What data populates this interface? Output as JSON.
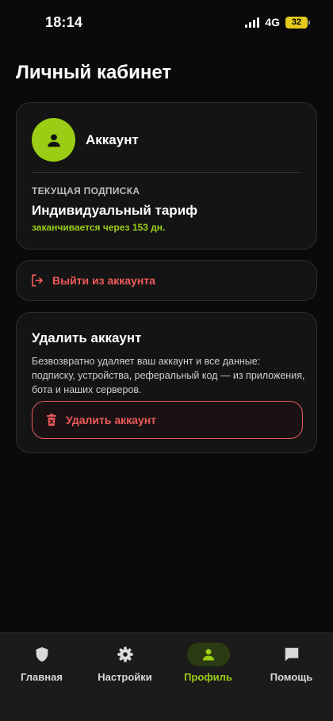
{
  "status_bar": {
    "time": "18:14",
    "network": "4G",
    "battery": "32"
  },
  "page_title": "Личный кабинет",
  "account": {
    "name": "Аккаунт",
    "subscription_label": "ТЕКУЩАЯ ПОДПИСКА",
    "plan": "Индивидуальный тариф",
    "expires": "заканчивается через 153 дн."
  },
  "logout": {
    "label": "Выйти из аккаунта"
  },
  "delete_section": {
    "title": "Удалить аккаунт",
    "description": "Безвозвратно удаляет ваш аккаунт и все данные: подписку, устройства, реферальный код — из приложения, бота и наших серверов.",
    "button_label": "Удалить аккаунт"
  },
  "tabs": [
    {
      "label": "Главная",
      "icon": "shield-icon",
      "active": false
    },
    {
      "label": "Настройки",
      "icon": "gear-icon",
      "active": false
    },
    {
      "label": "Профиль",
      "icon": "person-icon",
      "active": true
    },
    {
      "label": "Помощь",
      "icon": "chat-icon",
      "active": false
    }
  ],
  "colors": {
    "accent": "#9acd14",
    "danger": "#f05a5a",
    "background": "#0a0a0a",
    "card": "#141414"
  }
}
